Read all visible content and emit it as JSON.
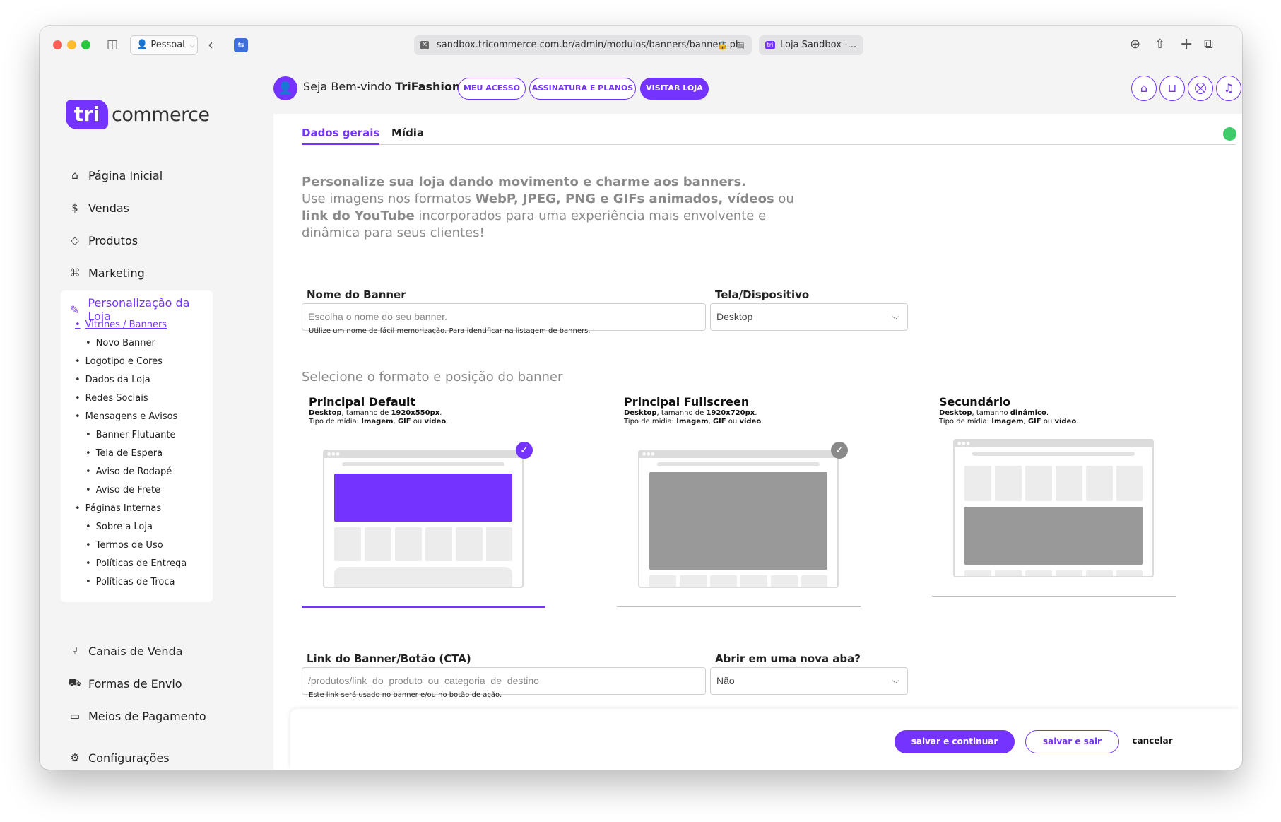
{
  "browser": {
    "profile_label": "Pessoal",
    "url": "sandbox.tricommerce.com.br/admin/modulos/banners/banners.ph",
    "second_tab": "Loja Sandbox -..."
  },
  "brand": {
    "badge": "tri",
    "name": "commerce",
    "accent": "#7433ff"
  },
  "header": {
    "welcome_prefix": "Seja Bem-vindo ",
    "welcome_name": "TriFashion",
    "btn_access": "MEU ACESSO",
    "btn_plans": "ASSINATURA E PLANOS",
    "btn_visit": "VISITAR LOJA"
  },
  "sidebar": {
    "home": "Página Inicial",
    "sales": "Vendas",
    "products": "Produtos",
    "marketing": "Marketing",
    "customization": "Personalização da Loja",
    "sub": {
      "showcases": "Vitrines / Banners",
      "new_banner": "Novo Banner",
      "logo_colors": "Logotipo e Cores",
      "store_data": "Dados da Loja",
      "social": "Redes Sociais",
      "messages": "Mensagens e Avisos",
      "floating_banner": "Banner Flutuante",
      "waiting_screen": "Tela de Espera",
      "footer_notice": "Aviso de Rodapé",
      "shipping_notice": "Aviso de Frete",
      "internal_pages": "Páginas Internas",
      "about": "Sobre a Loja",
      "terms": "Termos de Uso",
      "delivery_policy": "Políticas de Entrega",
      "exchange_policy": "Políticas de Troca"
    },
    "channels": "Canais de Venda",
    "shipping": "Formas de Envio",
    "payment": "Meios de Pagamento",
    "settings": "Configurações"
  },
  "tabs": {
    "general": "Dados gerais",
    "media": "Mídia"
  },
  "intro": {
    "line1": "Personalize sua loja dando movimento e charme aos banners.",
    "p1": "Use imagens nos formatos ",
    "b1": "WebP, JPEG, PNG e GIFs animados, vídeos",
    "p2": " ou ",
    "b2": "link do YouTube",
    "p3": " incorporados para uma experiência mais envolvente e dinâmica para seus clientes!"
  },
  "form": {
    "banner_name_label": "Nome do Banner",
    "banner_name_placeholder": "Escolha o nome do seu banner.",
    "banner_name_hint": "Utilize um nome de fácil memorização. Para identificar na listagem de banners.",
    "device_label": "Tela/Dispositivo",
    "device_value": "Desktop",
    "link_label": "Link do Banner/Botão (CTA)",
    "link_placeholder": "/produtos/link_do_produto_ou_categoria_de_destino",
    "link_hint": "Este link será usado no banner e/ou no botão de ação.",
    "new_tab_label": "Abrir em uma nova aba?",
    "new_tab_value": "Não"
  },
  "formats": {
    "section_title": "Selecione o formato e posição do banner",
    "items": [
      {
        "title": "Principal Default",
        "device": "Desktop",
        "size_prefix": ", tamanho de ",
        "size": "1920x550px",
        "media_prefix": "Tipo de mídia: ",
        "m1": "Imagem",
        "m2": "GIF",
        "m3": "vídeo",
        "selected": true
      },
      {
        "title": "Principal Fullscreen",
        "device": "Desktop",
        "size_prefix": ", tamanho de ",
        "size": "1920x720px",
        "media_prefix": "Tipo de mídia: ",
        "m1": "Imagem",
        "m2": "GIF",
        "m3": "vídeo",
        "selected": false
      },
      {
        "title": "Secundário",
        "device": "Desktop",
        "size_prefix": ", tamanho ",
        "size": "dinâmico",
        "media_prefix": "Tipo de mídia: ",
        "m1": "Imagem",
        "m2": "GIF",
        "m3": "vídeo",
        "selected": false
      }
    ],
    "sep_comma": ", ",
    "sep_or": " ou ",
    "sep_dot": "."
  },
  "actions": {
    "save_continue": "salvar e continuar",
    "save_exit": "salvar e sair",
    "cancel": "cancelar"
  },
  "colors": {
    "accent": "#7433ff",
    "status": "#3ecb6a",
    "logout": "#e54848"
  }
}
